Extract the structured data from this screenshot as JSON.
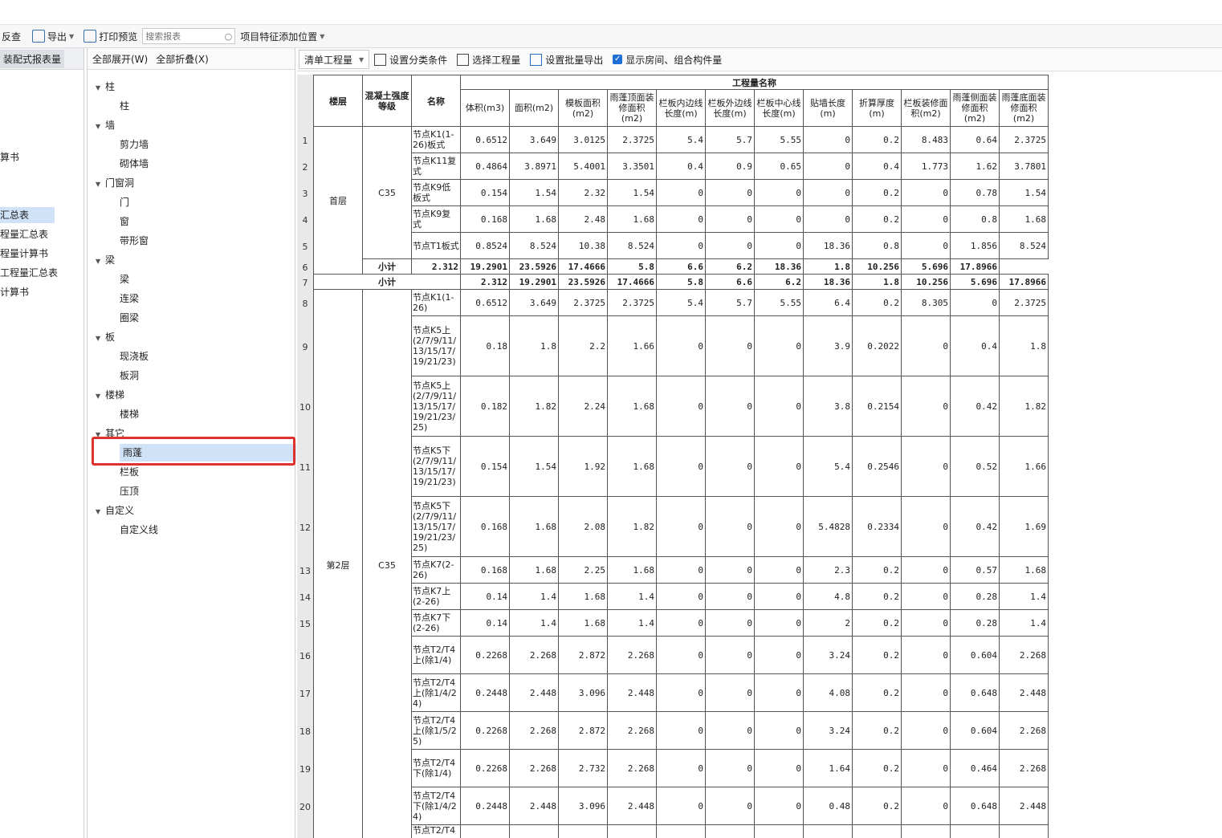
{
  "toolbar": {
    "check_label": "反查",
    "export_label": "导出",
    "print_label": "打印预览",
    "search_placeholder": "搜索报表",
    "feature_label": "项目特征添加位置"
  },
  "left_panel": {
    "header": "装配式报表量",
    "items": [
      {
        "label": "算书"
      },
      {
        "label": "汇总表"
      },
      {
        "label": "程量汇总表"
      },
      {
        "label": "程量计算书"
      },
      {
        "label": "工程量汇总表"
      },
      {
        "label": "计算书"
      }
    ]
  },
  "tree_panel": {
    "expand_all": "全部展开(W)",
    "collapse_all": "全部折叠(X)",
    "nodes": [
      {
        "label": "柱",
        "level": 0
      },
      {
        "label": "柱",
        "level": 1
      },
      {
        "label": "墙",
        "level": 0
      },
      {
        "label": "剪力墙",
        "level": 1
      },
      {
        "label": "砌体墙",
        "level": 1
      },
      {
        "label": "门窗洞",
        "level": 0
      },
      {
        "label": "门",
        "level": 1
      },
      {
        "label": "窗",
        "level": 1
      },
      {
        "label": "带形窗",
        "level": 1
      },
      {
        "label": "梁",
        "level": 0
      },
      {
        "label": "梁",
        "level": 1
      },
      {
        "label": "连梁",
        "level": 1
      },
      {
        "label": "圈梁",
        "level": 1
      },
      {
        "label": "板",
        "level": 0
      },
      {
        "label": "现浇板",
        "level": 1
      },
      {
        "label": "板洞",
        "level": 1
      },
      {
        "label": "楼梯",
        "level": 0
      },
      {
        "label": "楼梯",
        "level": 1
      },
      {
        "label": "其它",
        "level": 0
      },
      {
        "label": "雨蓬",
        "level": 1,
        "selected": true
      },
      {
        "label": "栏板",
        "level": 1
      },
      {
        "label": "压顶",
        "level": 1
      },
      {
        "label": "自定义",
        "level": 0
      },
      {
        "label": "自定义线",
        "level": 1
      }
    ]
  },
  "report_toolbar": {
    "dropdown": "清单工程量",
    "set_category": "设置分类条件",
    "select_quantity": "选择工程量",
    "batch_export": "设置批量导出",
    "show_rooms": "显示房间、组合构件量"
  },
  "table": {
    "h_floor": "楼层",
    "h_grade": "混凝土强度等级",
    "h_name": "名称",
    "h_group": "工程量名称",
    "columns": [
      "体积(m3)",
      "面积(m2)",
      "模板面积(m2)",
      "雨蓬顶面装修面积(m2)",
      "栏板内边线长度(m)",
      "栏板外边线长度(m)",
      "栏板中心线长度(m)",
      "贴墙长度(m)",
      "折算厚度(m)",
      "栏板装修面积(m2)",
      "雨蓬侧面装修面积(m2)",
      "雨蓬底面装修面积(m2)"
    ],
    "floor1": "首层",
    "floor2": "第2层",
    "grade1": "C35",
    "grade2": "C35",
    "subtotal_label": "小计",
    "total_label": "小计",
    "rows": [
      {
        "no": "1",
        "name": "节点K1(1-26)板式",
        "v": [
          "0.6512",
          "3.649",
          "3.0125",
          "2.3725",
          "5.4",
          "5.7",
          "5.55",
          "0",
          "0.2",
          "8.483",
          "0.64",
          "2.3725"
        ]
      },
      {
        "no": "2",
        "name": "节点K11复式",
        "v": [
          "0.4864",
          "3.8971",
          "5.4001",
          "3.3501",
          "0.4",
          "0.9",
          "0.65",
          "0",
          "0.4",
          "1.773",
          "1.62",
          "3.7801"
        ]
      },
      {
        "no": "3",
        "name": "节点K9低板式",
        "v": [
          "0.154",
          "1.54",
          "2.32",
          "1.54",
          "0",
          "0",
          "0",
          "0",
          "0.2",
          "0",
          "0.78",
          "1.54"
        ]
      },
      {
        "no": "4",
        "name": "节点K9复式",
        "v": [
          "0.168",
          "1.68",
          "2.48",
          "1.68",
          "0",
          "0",
          "0",
          "0",
          "0.2",
          "0",
          "0.8",
          "1.68"
        ]
      },
      {
        "no": "5",
        "name": "节点T1板式",
        "v": [
          "0.8524",
          "8.524",
          "10.38",
          "8.524",
          "0",
          "0",
          "0",
          "18.36",
          "0.8",
          "0",
          "1.856",
          "8.524"
        ]
      },
      {
        "no": "6",
        "sub": true,
        "v": [
          "2.312",
          "19.2901",
          "23.5926",
          "17.4666",
          "5.8",
          "6.6",
          "6.2",
          "18.36",
          "1.8",
          "10.256",
          "5.696",
          "17.8966"
        ]
      },
      {
        "no": "7",
        "total": true,
        "v": [
          "2.312",
          "19.2901",
          "23.5926",
          "17.4666",
          "5.8",
          "6.6",
          "6.2",
          "18.36",
          "1.8",
          "10.256",
          "5.696",
          "17.8966"
        ]
      },
      {
        "no": "8",
        "name": "节点K1(1-26)",
        "v": [
          "0.6512",
          "3.649",
          "2.3725",
          "2.3725",
          "5.4",
          "5.7",
          "5.55",
          "6.4",
          "0.2",
          "8.305",
          "0",
          "2.3725"
        ]
      },
      {
        "no": "9",
        "name": "节点K5上(2/7/9/11/13/15/17/19/21/23)",
        "v": [
          "0.18",
          "1.8",
          "2.2",
          "1.66",
          "0",
          "0",
          "0",
          "3.9",
          "0.2022",
          "0",
          "0.4",
          "1.8"
        ]
      },
      {
        "no": "10",
        "name": "节点K5上(2/7/9/11/13/15/17/19/21/23/25)",
        "v": [
          "0.182",
          "1.82",
          "2.24",
          "1.68",
          "0",
          "0",
          "0",
          "3.8",
          "0.2154",
          "0",
          "0.42",
          "1.82"
        ]
      },
      {
        "no": "11",
        "name": "节点K5下(2/7/9/11/13/15/17/19/21/23)",
        "v": [
          "0.154",
          "1.54",
          "1.92",
          "1.68",
          "0",
          "0",
          "0",
          "5.4",
          "0.2546",
          "0",
          "0.52",
          "1.66"
        ]
      },
      {
        "no": "12",
        "name": "节点K5下(2/7/9/11/13/15/17/19/21/23/25)",
        "v": [
          "0.168",
          "1.68",
          "2.08",
          "1.82",
          "0",
          "0",
          "0",
          "5.4828",
          "0.2334",
          "0",
          "0.42",
          "1.69"
        ]
      },
      {
        "no": "13",
        "name": "节点K7(2-26)",
        "v": [
          "0.168",
          "1.68",
          "2.25",
          "1.68",
          "0",
          "0",
          "0",
          "2.3",
          "0.2",
          "0",
          "0.57",
          "1.68"
        ]
      },
      {
        "no": "14",
        "name": "节点K7上(2-26)",
        "v": [
          "0.14",
          "1.4",
          "1.68",
          "1.4",
          "0",
          "0",
          "0",
          "4.8",
          "0.2",
          "0",
          "0.28",
          "1.4"
        ]
      },
      {
        "no": "15",
        "name": "节点K7下(2-26)",
        "v": [
          "0.14",
          "1.4",
          "1.68",
          "1.4",
          "0",
          "0",
          "0",
          "2",
          "0.2",
          "0",
          "0.28",
          "1.4"
        ]
      },
      {
        "no": "16",
        "name": "节点T2/T4上(除1/4)",
        "v": [
          "0.2268",
          "2.268",
          "2.872",
          "2.268",
          "0",
          "0",
          "0",
          "3.24",
          "0.2",
          "0",
          "0.604",
          "2.268"
        ]
      },
      {
        "no": "17",
        "name": "节点T2/T4上(除1/4/24)",
        "v": [
          "0.2448",
          "2.448",
          "3.096",
          "2.448",
          "0",
          "0",
          "0",
          "4.08",
          "0.2",
          "0",
          "0.648",
          "2.448"
        ]
      },
      {
        "no": "18",
        "name": "节点T2/T4上(除1/5/25)",
        "v": [
          "0.2268",
          "2.268",
          "2.872",
          "2.268",
          "0",
          "0",
          "0",
          "3.24",
          "0.2",
          "0",
          "0.604",
          "2.268"
        ]
      },
      {
        "no": "19",
        "name": "节点T2/T4下(除1/4)",
        "v": [
          "0.2268",
          "2.268",
          "2.732",
          "2.268",
          "0",
          "0",
          "0",
          "1.64",
          "0.2",
          "0",
          "0.464",
          "2.268"
        ]
      },
      {
        "no": "20",
        "name": "节点T2/T4下(除1/4/24)",
        "v": [
          "0.2448",
          "2.448",
          "3.096",
          "2.448",
          "0",
          "0",
          "0",
          "0.48",
          "0.2",
          "0",
          "0.648",
          "2.448"
        ]
      },
      {
        "no": "",
        "name": "节点T2/T4",
        "partial": true,
        "v": [
          "",
          "",
          "",
          "",
          "",
          "",
          "",
          "",
          "",
          "",
          "",
          ""
        ]
      }
    ]
  }
}
